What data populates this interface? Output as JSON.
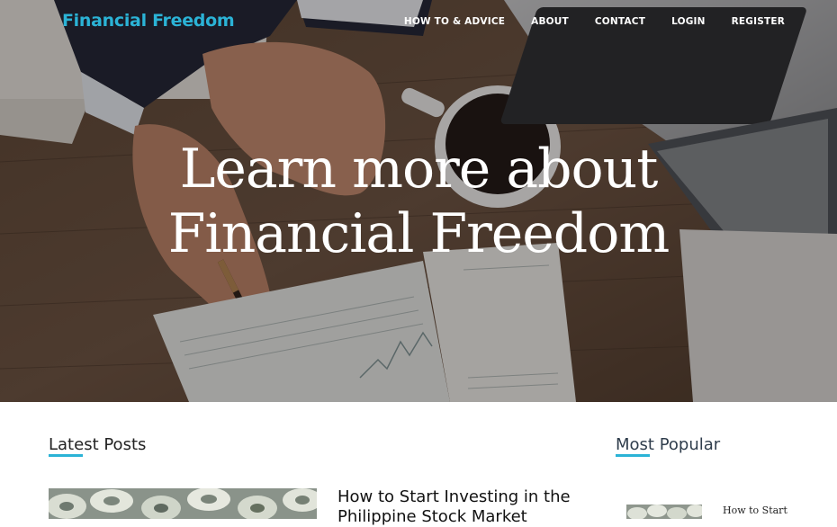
{
  "site": {
    "logo_text": "Financial Freedom"
  },
  "nav": {
    "items": [
      {
        "label": "HOW TO & ADVICE",
        "name": "nav-how-to-advice"
      },
      {
        "label": "ABOUT",
        "name": "nav-about"
      },
      {
        "label": "CONTACT",
        "name": "nav-contact"
      },
      {
        "label": "LOGIN",
        "name": "nav-login"
      },
      {
        "label": "REGISTER",
        "name": "nav-register"
      }
    ]
  },
  "hero": {
    "headline_line1": "Learn more about",
    "headline_line2": "Financial Freedom"
  },
  "latest": {
    "heading": "Latest Posts",
    "posts": [
      {
        "title": "How to Start Investing in the Philippine Stock Market"
      }
    ]
  },
  "popular": {
    "heading": "Most Popular",
    "posts": [
      {
        "title": "How to Start"
      }
    ]
  },
  "colors": {
    "accent": "#2bb3d6",
    "heading_dark": "#2f3d4c"
  }
}
